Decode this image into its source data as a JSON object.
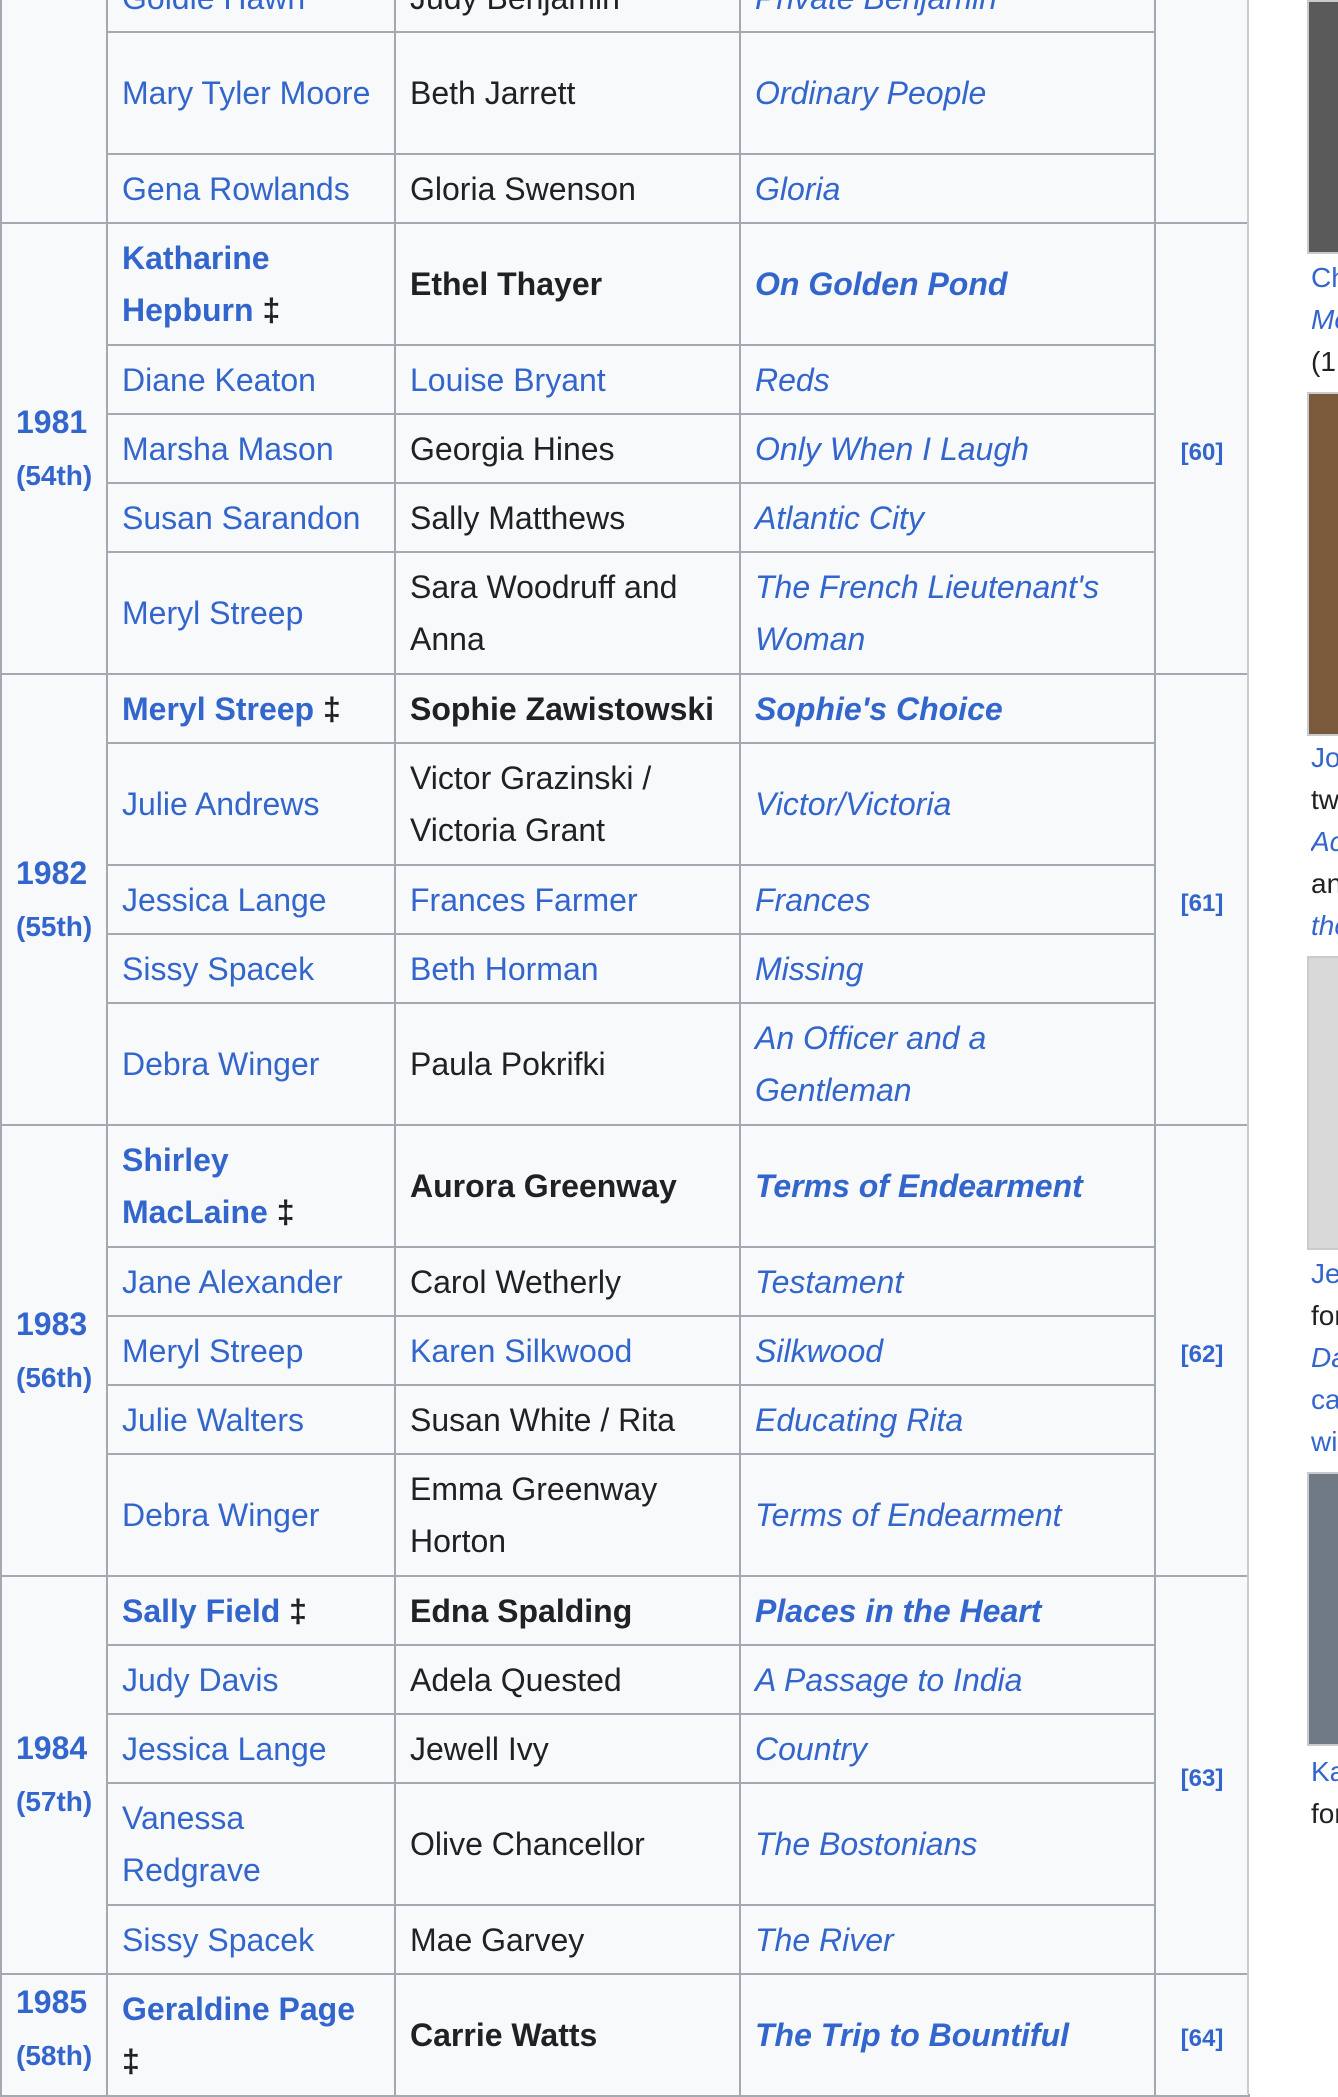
{
  "table": {
    "rows": [
      {
        "actress": "Goldie Hawn",
        "actress_link": true,
        "role": "Judy Benjamin",
        "role_link": false,
        "film": "Private Benjamin",
        "winner": false
      },
      {
        "actress": "Mary Tyler Moore",
        "actress_link": true,
        "role": "Beth Jarrett",
        "role_link": false,
        "film": "Ordinary People",
        "winner": false
      },
      {
        "actress": "Gena Rowlands",
        "actress_link": true,
        "role": "Gloria Swenson",
        "role_link": false,
        "film": "Gloria",
        "winner": false
      },
      {
        "actress": "Katharine Hepburn",
        "dagger": "‡",
        "actress_link": true,
        "role": "Ethel Thayer",
        "role_link": false,
        "film": "On Golden Pond",
        "winner": true
      },
      {
        "actress": "Diane Keaton",
        "actress_link": true,
        "role": "Louise Bryant",
        "role_link": true,
        "film": "Reds",
        "winner": false
      },
      {
        "actress": "Marsha Mason",
        "actress_link": true,
        "role": "Georgia Hines",
        "role_link": false,
        "film": "Only When I Laugh",
        "winner": false
      },
      {
        "actress": "Susan Sarandon",
        "actress_link": true,
        "role": "Sally Matthews",
        "role_link": false,
        "film": "Atlantic City",
        "winner": false
      },
      {
        "actress": "Meryl Streep",
        "actress_link": true,
        "role": "Sara Woodruff and Anna",
        "role_link": false,
        "film": "The French Lieutenant's Woman",
        "winner": false
      },
      {
        "actress": "Meryl Streep",
        "dagger": "‡",
        "actress_link": true,
        "role": "Sophie Zawistowski",
        "role_link": false,
        "film": "Sophie's Choice",
        "winner": true
      },
      {
        "actress": "Julie Andrews",
        "actress_link": true,
        "role": "Victor Grazinski / Victoria Grant",
        "role_link": false,
        "film": "Victor/Victoria",
        "winner": false
      },
      {
        "actress": "Jessica Lange",
        "actress_link": true,
        "role": "Frances Farmer",
        "role_link": true,
        "film": "Frances",
        "winner": false
      },
      {
        "actress": "Sissy Spacek",
        "actress_link": true,
        "role": "Beth Horman",
        "role_link": true,
        "film": "Missing",
        "winner": false
      },
      {
        "actress": "Debra Winger",
        "actress_link": true,
        "role": "Paula Pokrifki",
        "role_link": false,
        "film": "An Officer and a Gentleman",
        "winner": false
      },
      {
        "actress": "Shirley MacLaine",
        "dagger": "‡",
        "actress_link": true,
        "role": "Aurora Greenway",
        "role_link": false,
        "film": "Terms of Endearment",
        "winner": true
      },
      {
        "actress": "Jane Alexander",
        "actress_link": true,
        "role": "Carol Wetherly",
        "role_link": false,
        "film": "Testament",
        "winner": false
      },
      {
        "actress": "Meryl Streep",
        "actress_link": true,
        "role": "Karen Silkwood",
        "role_link": true,
        "film": "Silkwood",
        "winner": false
      },
      {
        "actress": "Julie Walters",
        "actress_link": true,
        "role": "Susan White / Rita",
        "role_link": false,
        "film": "Educating Rita",
        "winner": false
      },
      {
        "actress": "Debra Winger",
        "actress_link": true,
        "role": "Emma Greenway Horton",
        "role_link": false,
        "film": "Terms of Endearment",
        "winner": false
      },
      {
        "actress": "Sally Field",
        "dagger": "‡",
        "actress_link": true,
        "role": "Edna Spalding",
        "role_link": false,
        "film": "Places in the Heart",
        "winner": true
      },
      {
        "actress": "Judy Davis",
        "actress_link": true,
        "role": "Adela Quested",
        "role_link": false,
        "film": "A Passage to India",
        "winner": false
      },
      {
        "actress": "Jessica Lange",
        "actress_link": true,
        "role": "Jewell Ivy",
        "role_link": false,
        "film": "Country",
        "winner": false
      },
      {
        "actress": "Vanessa Redgrave",
        "actress_link": true,
        "role": "Olive Chancellor",
        "role_link": false,
        "film": "The Bostonians",
        "winner": false
      },
      {
        "actress": "Sissy Spacek",
        "actress_link": true,
        "role": "Mae Garvey",
        "role_link": false,
        "film": "The River",
        "winner": false
      },
      {
        "actress": "Geraldine Page",
        "dagger": "‡",
        "actress_link": true,
        "role": "Carrie Watts",
        "role_link": false,
        "film": "The Trip to Bountiful",
        "winner": true
      }
    ],
    "years": [
      {
        "year": "1981",
        "ceremony": "(54th)",
        "ref": "[60]"
      },
      {
        "year": "1982",
        "ceremony": "(55th)",
        "ref": "[61]"
      },
      {
        "year": "1983",
        "ceremony": "(56th)",
        "ref": "[62]"
      },
      {
        "year": "1984",
        "ceremony": "(57th)",
        "ref": "[63]"
      },
      {
        "year": "1985",
        "ceremony": "(58th)",
        "ref": "[64]"
      }
    ]
  },
  "sidebar": {
    "captions": [
      {
        "lines": [
          "Ch",
          "Mo",
          "(1"
        ]
      },
      {
        "lines": [
          "Jo",
          "tw",
          "Ac",
          "an",
          "the"
        ]
      },
      {
        "lines": [
          "Je",
          "for",
          "Da",
          "ca",
          "wi"
        ]
      },
      {
        "lines": [
          "Ka",
          "for"
        ]
      }
    ]
  }
}
